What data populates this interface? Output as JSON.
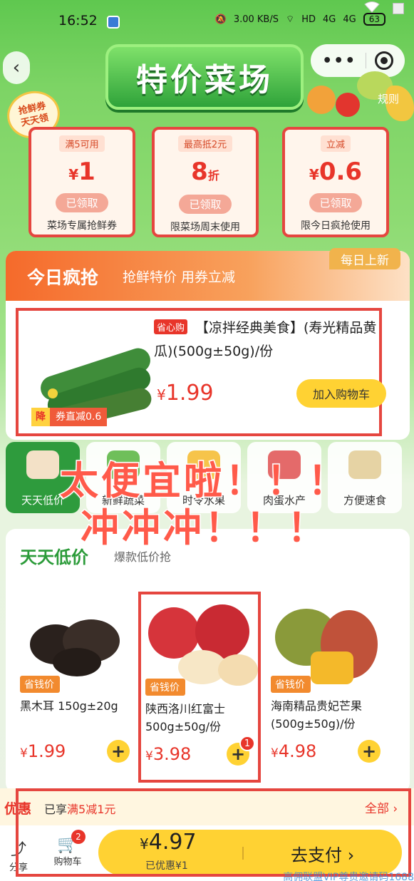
{
  "status": {
    "time": "16:52",
    "net_speed": "3.00 KB/S",
    "signal_a": "4G",
    "signal_b": "4G",
    "hd": "HD",
    "battery": "63"
  },
  "header": {
    "title": "特价菜场",
    "rules": "规则",
    "badge_line1": "抢鲜券",
    "badge_line2": "天天领"
  },
  "coupons": [
    {
      "cond": "满5可用",
      "currency": "¥",
      "amount": "1",
      "unit": "",
      "status": "已领取",
      "desc": "菜场专属抢鲜券"
    },
    {
      "cond": "最高抵2元",
      "currency": "",
      "amount": "8",
      "unit": "折",
      "status": "已领取",
      "desc": "限菜场周末使用"
    },
    {
      "cond": "立减",
      "currency": "¥",
      "amount": "0.6",
      "unit": "",
      "status": "已领取",
      "desc": "限今日疯抢使用"
    }
  ],
  "daily": {
    "title": "今日疯抢",
    "subtitle": "抢鲜特价 用券立减",
    "new_badge": "每日上新",
    "deal": {
      "tag": "省心购",
      "name": "【凉拌经典美食】(寿光精品黄瓜)(500g±50g)/份",
      "currency": "¥",
      "price": "1.99",
      "add_label": "加入购物车",
      "coupon_mark": "降",
      "coupon_text": "券直减0.6"
    }
  },
  "categories": [
    {
      "label": "天天低价"
    },
    {
      "label": "新鲜蔬菜"
    },
    {
      "label": "时令水果"
    },
    {
      "label": "肉蛋水产"
    },
    {
      "label": "方便速食"
    }
  ],
  "slogan": {
    "line1": "太便宜啦！！！",
    "line2": "冲冲冲！！！"
  },
  "section": {
    "title": "天天低价",
    "subtitle": "爆款低价抢"
  },
  "products": [
    {
      "tag": "省钱价",
      "name": "黑木耳 150g±20g",
      "currency": "¥",
      "price": "1.99",
      "qty": ""
    },
    {
      "tag": "省钱价",
      "name": "陕西洛川红富士 500g±50g/份",
      "currency": "¥",
      "price": "3.98",
      "qty": "1"
    },
    {
      "tag": "省钱价",
      "name": "海南精品贵妃芒果(500g±50g)/份",
      "currency": "¥",
      "price": "4.98",
      "qty": ""
    }
  ],
  "offer": {
    "label": "优惠",
    "text_prefix": "已享",
    "text_highlight": "满5减1元",
    "all": "全部 ›"
  },
  "bottom_bar": {
    "share": "分享",
    "cart": "购物车",
    "cart_count": "2",
    "currency": "¥",
    "total": "4.97",
    "saved": "已优惠¥1",
    "pay": "去支付 ›"
  },
  "watermark": "高佣联盟VIP尊贵邀请码1688"
}
